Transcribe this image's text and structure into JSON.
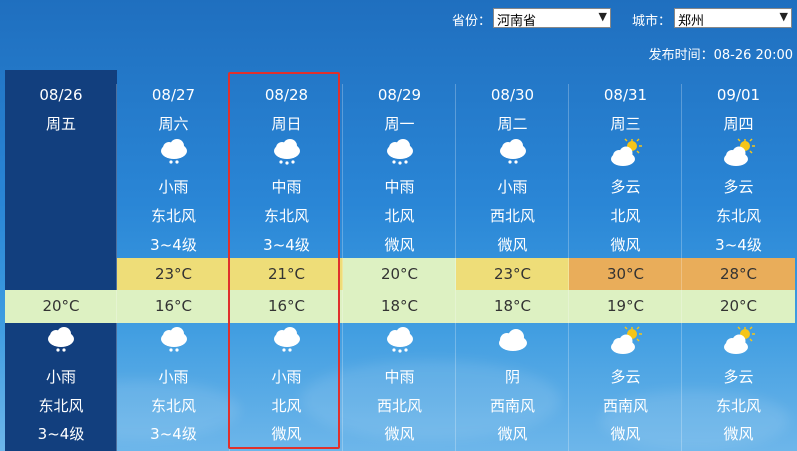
{
  "header": {
    "province_label": "省份：",
    "province_value": "河南省",
    "city_label": "城市：",
    "city_value": "郑州",
    "publish_time": "发布时间：08-26 20:00"
  },
  "days": [
    {
      "date": "08/26",
      "weekday": "周五",
      "day_icon": "",
      "day_weather": "",
      "day_wind": "",
      "day_level": "",
      "high": "",
      "low": "20°C",
      "night_icon": "light-rain-icon",
      "night_weather": "小雨",
      "night_wind": "东北风",
      "night_level": "3~4级"
    },
    {
      "date": "08/27",
      "weekday": "周六",
      "day_icon": "light-rain-icon",
      "day_weather": "小雨",
      "day_wind": "东北风",
      "day_level": "3~4级",
      "high": "23°C",
      "low": "16°C",
      "night_icon": "light-rain-icon",
      "night_weather": "小雨",
      "night_wind": "东北风",
      "night_level": "3~4级"
    },
    {
      "date": "08/28",
      "weekday": "周日",
      "day_icon": "moderate-rain-icon",
      "day_weather": "中雨",
      "day_wind": "东北风",
      "day_level": "3~4级",
      "high": "21°C",
      "low": "16°C",
      "night_icon": "light-rain-icon",
      "night_weather": "小雨",
      "night_wind": "北风",
      "night_level": "微风"
    },
    {
      "date": "08/29",
      "weekday": "周一",
      "day_icon": "moderate-rain-icon",
      "day_weather": "中雨",
      "day_wind": "北风",
      "day_level": "微风",
      "high": "20°C",
      "low": "18°C",
      "night_icon": "moderate-rain-icon",
      "night_weather": "中雨",
      "night_wind": "西北风",
      "night_level": "微风"
    },
    {
      "date": "08/30",
      "weekday": "周二",
      "day_icon": "light-rain-icon",
      "day_weather": "小雨",
      "day_wind": "西北风",
      "day_level": "微风",
      "high": "23°C",
      "low": "18°C",
      "night_icon": "overcast-icon",
      "night_weather": "阴",
      "night_wind": "西南风",
      "night_level": "微风"
    },
    {
      "date": "08/31",
      "weekday": "周三",
      "day_icon": "partly-cloudy-icon",
      "day_weather": "多云",
      "day_wind": "北风",
      "day_level": "微风",
      "high": "30°C",
      "low": "19°C",
      "night_icon": "partly-cloudy-icon",
      "night_weather": "多云",
      "night_wind": "西南风",
      "night_level": "微风"
    },
    {
      "date": "09/01",
      "weekday": "周四",
      "day_icon": "partly-cloudy-icon",
      "day_weather": "多云",
      "day_wind": "东北风",
      "day_level": "3~4级",
      "high": "28°C",
      "low": "20°C",
      "night_icon": "partly-cloudy-icon",
      "night_weather": "多云",
      "night_wind": "东北风",
      "night_level": "微风"
    }
  ],
  "colors": {
    "today_bg": "#123f7e",
    "highlight_border": "#e0302c",
    "high_band": [
      "",
      "#eedd78",
      "#eedd78",
      "#ddf1c2",
      "#eedd78",
      "#e9ad5a",
      "#e9ad5a"
    ],
    "low_band": "#ddf1c2"
  }
}
